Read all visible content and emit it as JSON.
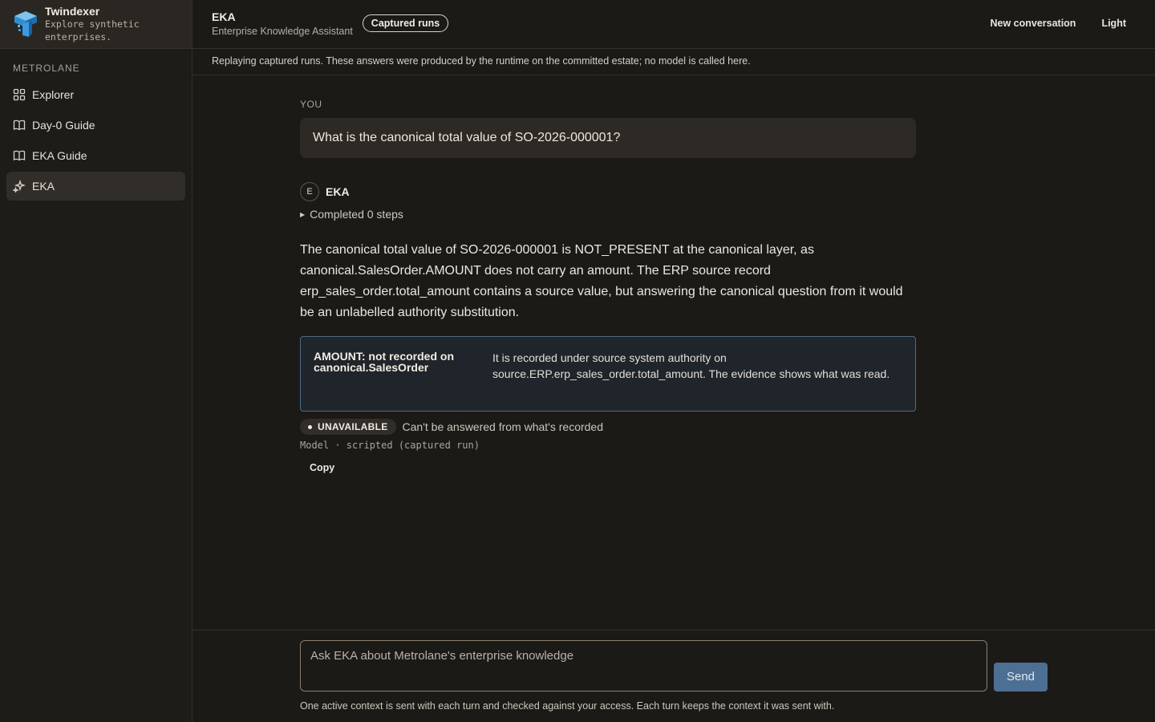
{
  "brand": {
    "name": "Twindexer",
    "tagline": "Explore synthetic enterprises."
  },
  "sidebar": {
    "org_label": "METROLANE",
    "items": [
      {
        "label": "Explorer",
        "icon": "grid-icon",
        "active": false
      },
      {
        "label": "Day-0 Guide",
        "icon": "book-icon",
        "active": false
      },
      {
        "label": "EKA Guide",
        "icon": "book-icon",
        "active": false
      },
      {
        "label": "EKA",
        "icon": "sparkle-icon",
        "active": true
      }
    ]
  },
  "header": {
    "title": "EKA",
    "subtitle": "Enterprise Knowledge Assistant",
    "mode_pill": "Captured runs",
    "new_conversation": "New conversation",
    "theme_toggle": "Light"
  },
  "banner": "Replaying captured runs. These answers were produced by the runtime on the committed estate; no model is called here.",
  "conversation": {
    "user_label": "YOU",
    "user_message": "What is the canonical total value of SO-2026-000001?",
    "assistant_avatar": "E",
    "assistant_name": "EKA",
    "steps": "Completed 0 steps",
    "answer": "The canonical total value of SO-2026-000001 is NOT_PRESENT at the canonical layer, as canonical.SalesOrder.AMOUNT does not carry an amount. The ERP source record erp_sales_order.total_amount contains a source value, but answering the canonical question from it would be an unlabelled authority substitution.",
    "callout": {
      "title": "AMOUNT: not recorded on canonical.SalesOrder",
      "body": "It is recorded under source system authority on source.ERP.erp_sales_order.total_amount. The evidence shows what was read."
    },
    "status_badge": "UNAVAILABLE",
    "status_text": "Can't be answered from what's recorded",
    "model_line": "Model · scripted (captured run)",
    "copy_label": "Copy"
  },
  "composer": {
    "placeholder": "Ask EKA about Metrolane's enterprise knowledge",
    "send_label": "Send",
    "note": "One active context is sent with each turn and checked against your access. Each turn keeps the context it was sent with."
  },
  "colors": {
    "background": "#1c1a17",
    "accent_blue": "#4d6f94",
    "callout_border": "#4d6b86",
    "composer_border": "#8a7e6c"
  }
}
